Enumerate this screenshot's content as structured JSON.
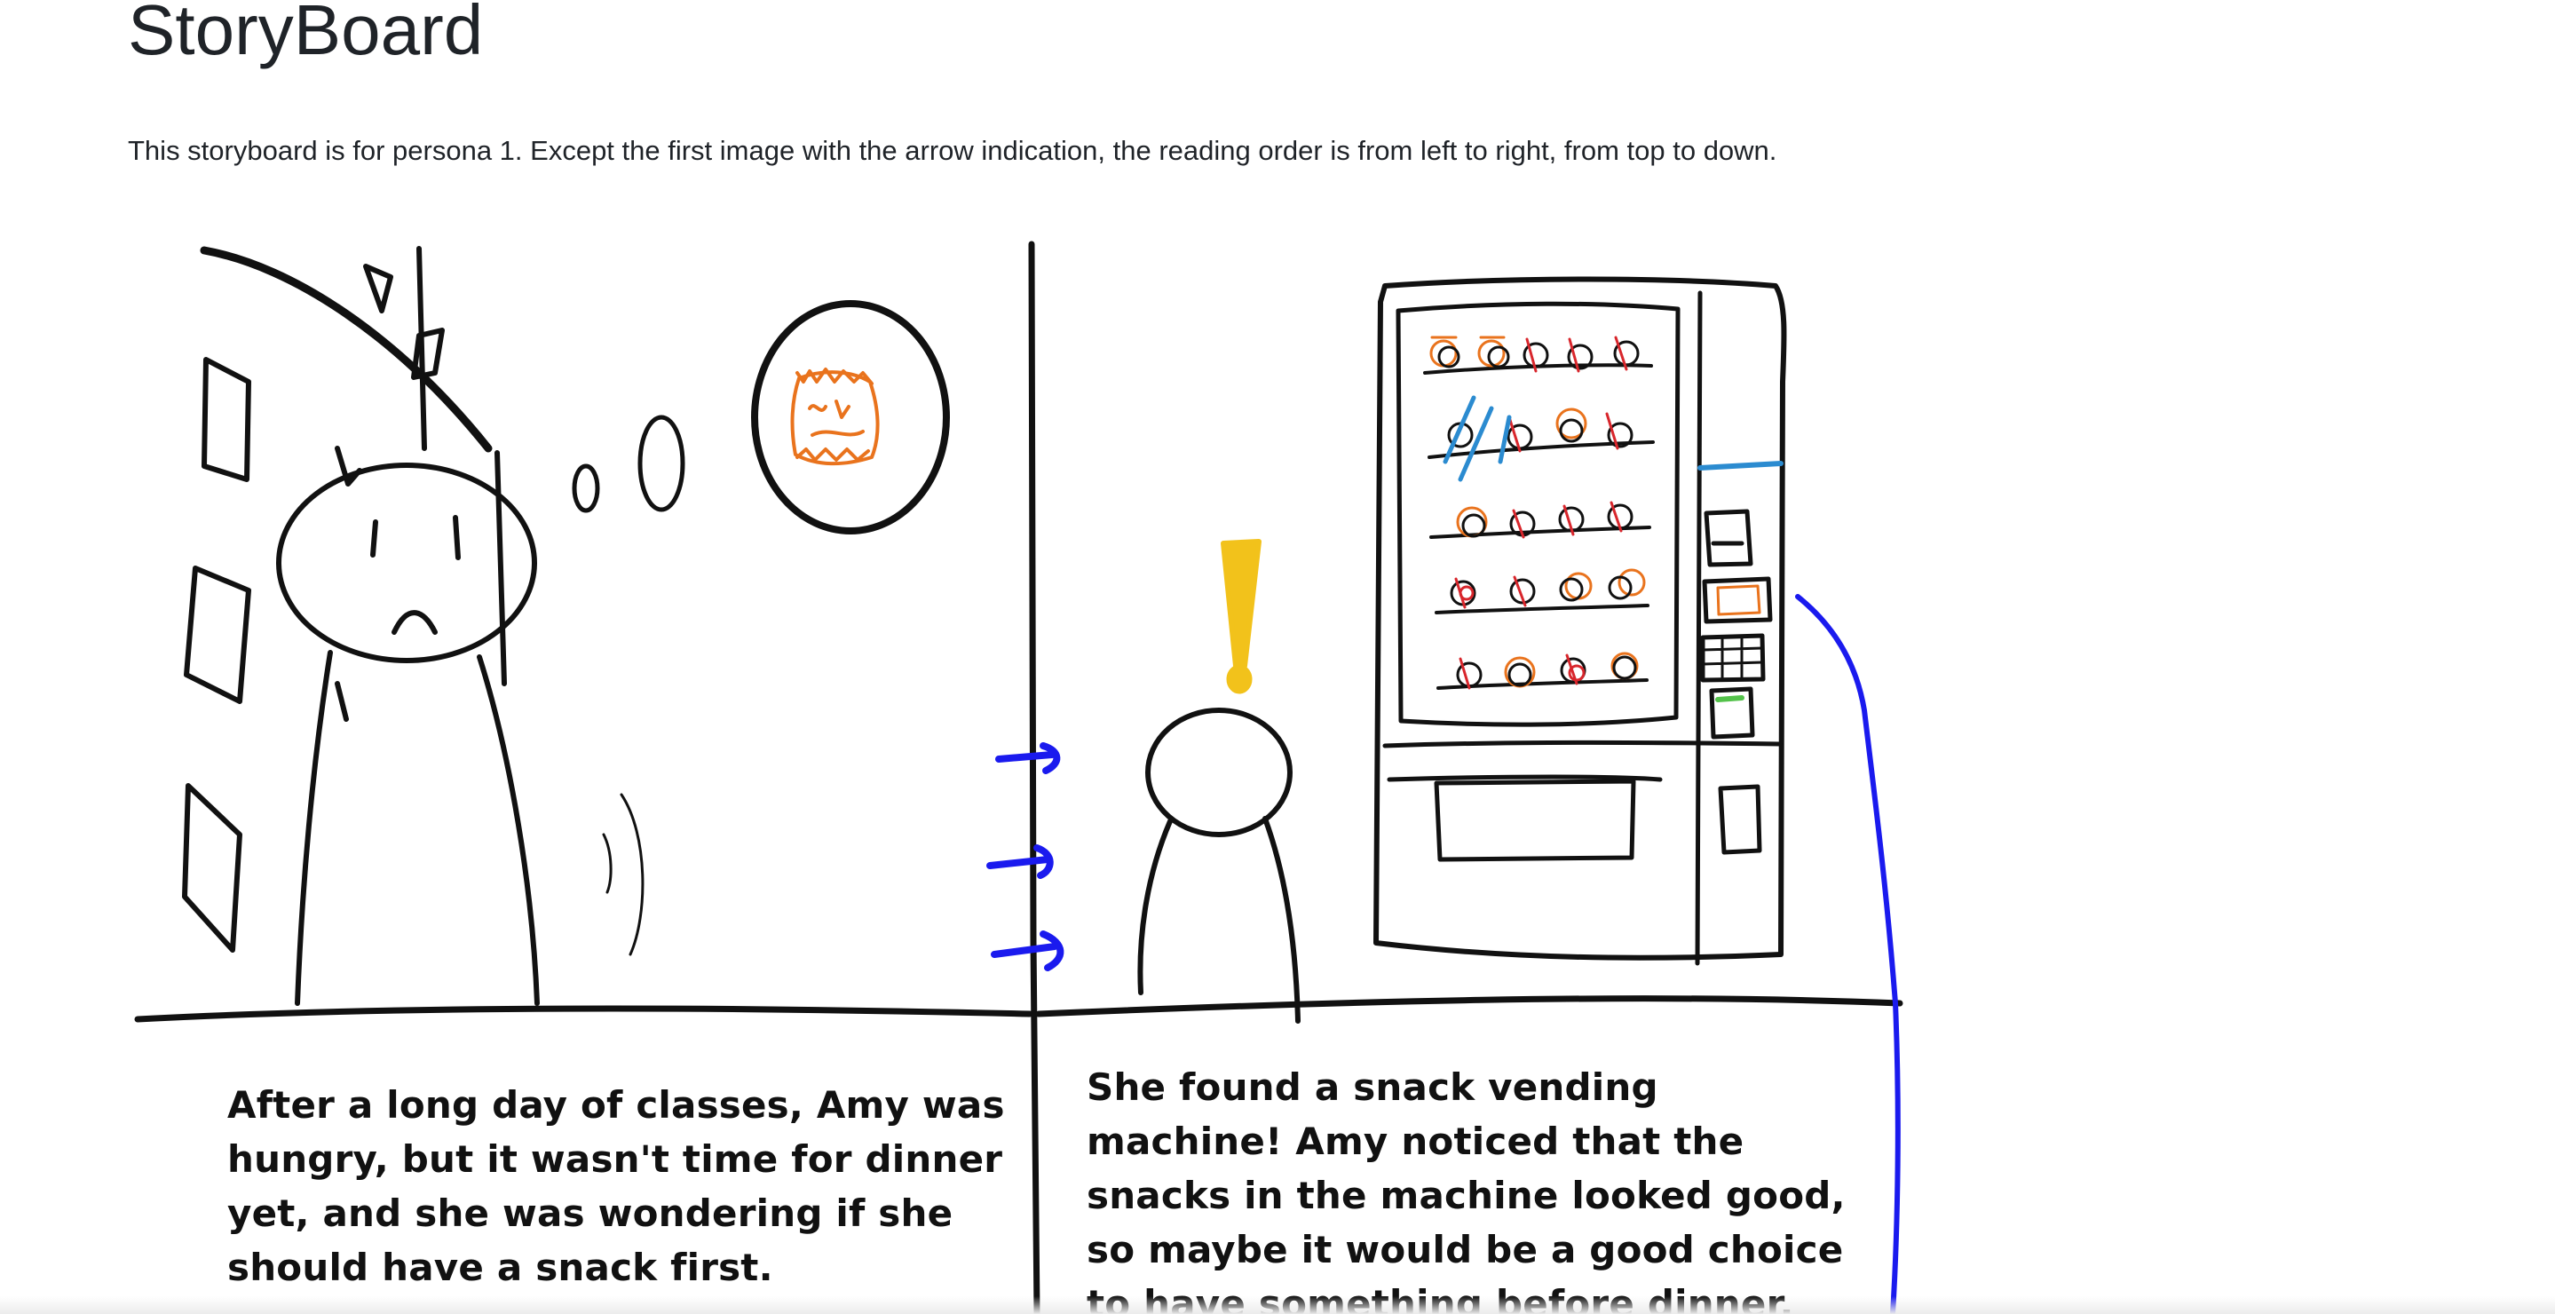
{
  "page": {
    "title": "StoryBoard",
    "intro": "This storyboard is for persona 1. Except the first image with the arrow indication, the reading order is from left to right, from top to down."
  },
  "storyboard": {
    "panels": [
      {
        "caption": "After a long day of classes, Amy was hungry, but it wasn't time for dinner yet, and she was wondering if she should have a snack first.",
        "icons": [
          "building-sketch",
          "amy-sad-figure",
          "thought-bubble-icon",
          "snack-package-icon"
        ]
      },
      {
        "caption": "She found a snack vending machine! Amy noticed that the snacks in the machine looked good, so maybe it would be a good choice to have something before dinner.",
        "icons": [
          "amy-figure",
          "exclamation-icon",
          "vending-machine-sketch"
        ]
      }
    ],
    "colors": {
      "ink": "#111111",
      "arrow_blue": "#1a1aee",
      "exclamation_yellow": "#f2c21b",
      "snack_orange": "#e9731d",
      "snack_red": "#d8262c",
      "glass_blue": "#2b8bd0",
      "panel_green": "#53c24a"
    }
  }
}
